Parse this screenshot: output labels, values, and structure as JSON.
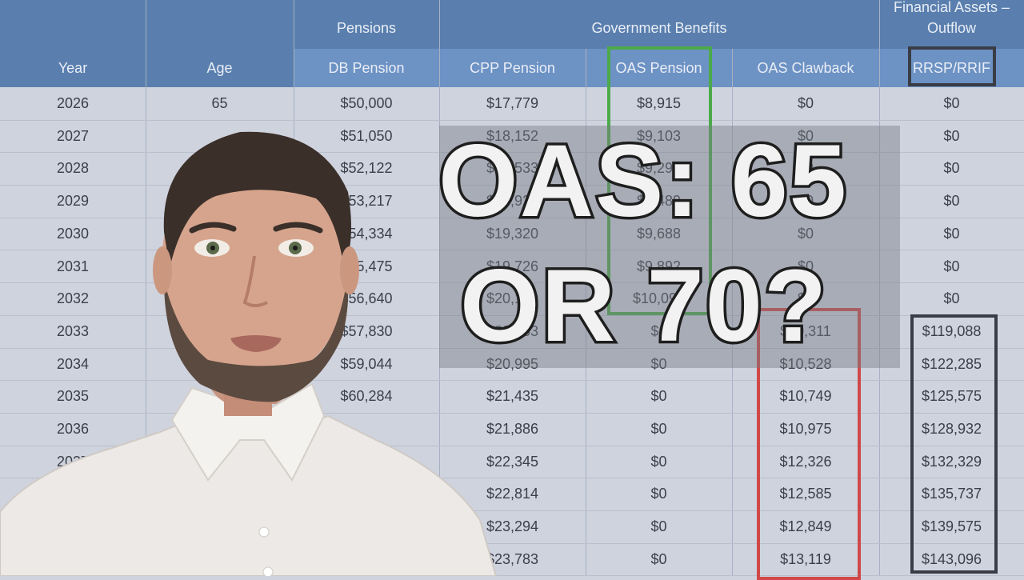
{
  "table": {
    "group_headers": {
      "pensions": "Pensions",
      "government_benefits": "Government Benefits",
      "financial_assets_line1": "Financial Assets –",
      "financial_assets_line2": "Outflow"
    },
    "columns": [
      "Year",
      "Age",
      "DB Pension",
      "CPP Pension",
      "OAS Pension",
      "OAS Clawback",
      "RRSP/RRIF"
    ],
    "rows": [
      [
        "2026",
        "65",
        "$50,000",
        "$17,779",
        "$8,915",
        "$0",
        "$0"
      ],
      [
        "2027",
        "",
        "$51,050",
        "$18,152",
        "$9,103",
        "$0",
        "$0"
      ],
      [
        "2028",
        "",
        "$52,122",
        "$18,533",
        "$9,294",
        "$0",
        "$0"
      ],
      [
        "2029",
        "",
        "$53,217",
        "$18,922",
        "$9,489",
        "$0",
        "$0"
      ],
      [
        "2030",
        "",
        "$54,334",
        "$19,320",
        "$9,688",
        "$0",
        "$0"
      ],
      [
        "2031",
        "",
        "$55,475",
        "$19,726",
        "$9,892",
        "$0",
        "$0"
      ],
      [
        "2032",
        "",
        "$56,640",
        "$20,140",
        "$10,099",
        "$0",
        "$0"
      ],
      [
        "2033",
        "",
        "$57,830",
        "$20,563",
        "$0",
        "$10,311",
        "$119,088"
      ],
      [
        "2034",
        "",
        "$59,044",
        "$20,995",
        "$0",
        "$10,528",
        "$122,285"
      ],
      [
        "2035",
        "",
        "$60,284",
        "$21,435",
        "$0",
        "$10,749",
        "$125,575"
      ],
      [
        "2036",
        "",
        "",
        "$21,886",
        "$0",
        "$10,975",
        "$128,932"
      ],
      [
        "2037",
        "",
        "",
        "$22,345",
        "$0",
        "$12,326",
        "$132,329"
      ],
      [
        "",
        "",
        "",
        "$22,814",
        "$0",
        "$12,585",
        "$135,737"
      ],
      [
        "",
        "",
        "",
        "$23,294",
        "$0",
        "$12,849",
        "$139,575"
      ],
      [
        "",
        "",
        "",
        "$23,783",
        "$0",
        "$13,119",
        "$143,096"
      ]
    ]
  },
  "title": {
    "line1": "OAS: 65",
    "line2": "OR 70?"
  },
  "colors": {
    "header_bg": "#5a7fae",
    "header_highlight": "#6d92c4",
    "table_bg": "#cfd3de",
    "green_box": "#4caa4a",
    "red_box": "#d04848",
    "dark_box": "#3a3d46"
  }
}
